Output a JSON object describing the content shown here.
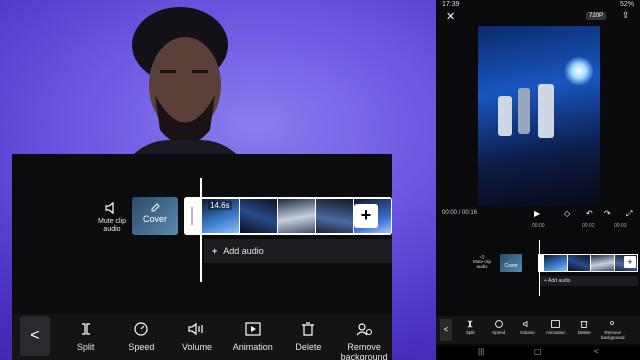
{
  "editor": {
    "mute_label_1": "Mute clip",
    "mute_label_2": "audio",
    "cover_label": "Cover",
    "clip_duration": "14.6s",
    "add_audio_label": "Add audio",
    "plus_symbol": "+",
    "back_symbol": "<",
    "tools": [
      {
        "label": "Split",
        "icon": "split-icon"
      },
      {
        "label": "Speed",
        "icon": "speed-icon"
      },
      {
        "label": "Volume",
        "icon": "volume-icon"
      },
      {
        "label": "Animation",
        "icon": "animation-icon"
      },
      {
        "label": "Delete",
        "icon": "delete-icon"
      },
      {
        "label": "Remove background",
        "icon": "remove-background-icon"
      }
    ]
  },
  "phone": {
    "status_time": "17:39",
    "battery": "52%",
    "resolution": "720P",
    "time_current": "00:00",
    "time_total": "00:16",
    "ruler": [
      "00:00",
      "00:02",
      "00:03"
    ],
    "mute_label": "Mute clip audio",
    "cover_label": "Cover",
    "add_audio_label": "Add audio",
    "tools": [
      {
        "label": "Split"
      },
      {
        "label": "Speed"
      },
      {
        "label": "Volume"
      },
      {
        "label": "Animation"
      },
      {
        "label": "Delete"
      },
      {
        "label": "Remove background"
      }
    ]
  }
}
